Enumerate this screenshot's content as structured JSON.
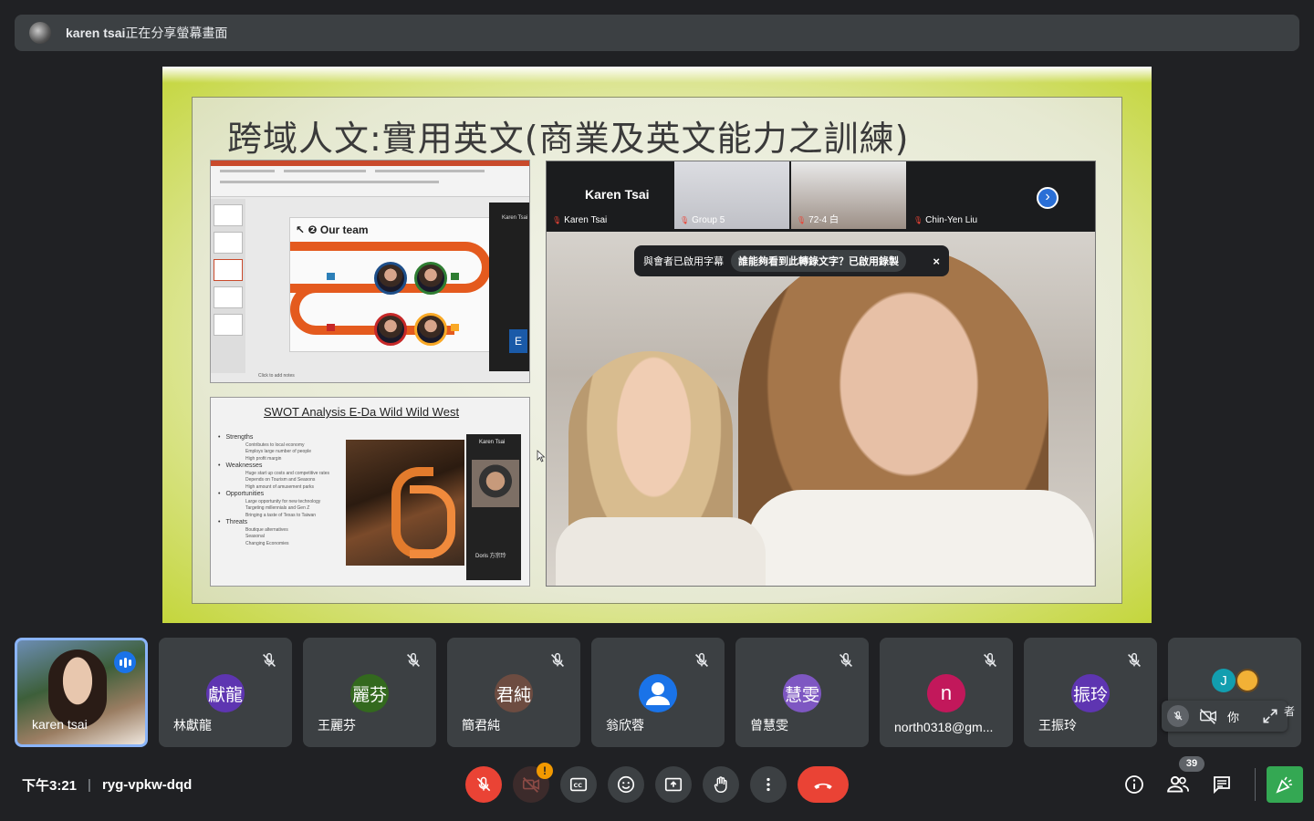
{
  "banner": {
    "presenter": "karen tsai",
    "suffix": "正在分享螢幕畫面"
  },
  "slide": {
    "title": "跨域人文:實用英文(商業及英文能力之訓練)",
    "team_heading": "Our team",
    "team_step": "2",
    "presenter_side_name": "Karen Tsai",
    "side_letter": "E",
    "notes_hint": "Click to add notes",
    "swot": {
      "title": "SWOT Analysis E-Da Wild Wild West",
      "sections": [
        {
          "label": "Strengths",
          "items": [
            "Contributes to local economy",
            "Employs large number of people",
            "High profit margin"
          ]
        },
        {
          "label": "Weaknesses",
          "items": [
            "Huge start up costs and competitive rates",
            "Depends on Tourism and Seasons",
            "High amount of amusement parks"
          ]
        },
        {
          "label": "Opportunities",
          "items": [
            "Large opportunity for new technology",
            "Targeting millennials and Gen Z",
            "Bringing a taste of Texas to Taiwan"
          ]
        },
        {
          "label": "Threats",
          "items": [
            "Boutique alternatives",
            "Seasonal",
            "Changing Economies"
          ]
        }
      ],
      "cam_name": "Karen Tsai",
      "cam_name2": "Doris 方宗玲"
    },
    "meet": {
      "main_name": "Karen Tsai",
      "tiles": [
        "Karen Tsai",
        "Group 5",
        "72-4 白",
        "Chin-Yen Liu"
      ],
      "caption_text": "與會者已啟用字幕",
      "caption_pill": "誰能夠看到此轉錄文字？已啟用錄製",
      "caption_close": "×"
    }
  },
  "participants": [
    {
      "name": "karen tsai",
      "self": true
    },
    {
      "name": "林獻龍",
      "initials": "獻龍",
      "color": "#5e35b1"
    },
    {
      "name": "王麗芬",
      "initials": "麗芬",
      "color": "#33691e"
    },
    {
      "name": "簡君純",
      "initials": "君純",
      "color": "#6d4c41"
    },
    {
      "name": "翁欣蓉",
      "initials": "",
      "color": "#1a73e8"
    },
    {
      "name": "曾慧雯",
      "initials": "慧雯",
      "color": "#7e57c2"
    },
    {
      "name": "north0318@gm...",
      "initials": "n",
      "color": "#c2185b"
    },
    {
      "name": "王振玲",
      "initials": "振玲",
      "color": "#5e35b1"
    }
  ],
  "extra_tile": {
    "letter": "J",
    "you_label": "你",
    "overflow_char": "者"
  },
  "bottom": {
    "time": "下午3:21",
    "meeting_code": "ryg-vpkw-dqd",
    "camera_badge": "!",
    "people_count": "39"
  }
}
